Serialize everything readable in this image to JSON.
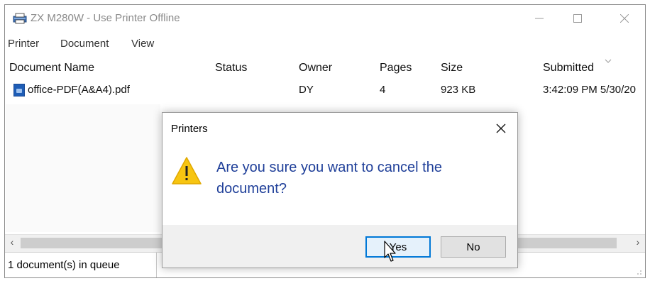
{
  "window": {
    "title": "ZX M280W  -  Use Printer Offline"
  },
  "menu": [
    "Printer",
    "Document",
    "View"
  ],
  "columns": [
    "Document Name",
    "Status",
    "Owner",
    "Pages",
    "Size",
    "Submitted"
  ],
  "jobs": [
    {
      "name": "office-PDF(A&A4).pdf",
      "status": "",
      "owner": "DY",
      "pages": "4",
      "size": "923 KB",
      "submitted": "3:42:09 PM  5/30/20"
    }
  ],
  "statusbar": {
    "text": "1 document(s) in queue"
  },
  "dialog": {
    "title": "Printers",
    "message": "Are you sure you want to cancel the document?",
    "yes_label": "Yes",
    "no_label": "No"
  },
  "colors": {
    "accent": "#0078d7",
    "message_text": "#1f3f99",
    "warning": "#f7c511"
  },
  "icons": {
    "printer": "printer-icon",
    "file": "pdf-file-icon",
    "warning": "warning-icon"
  }
}
